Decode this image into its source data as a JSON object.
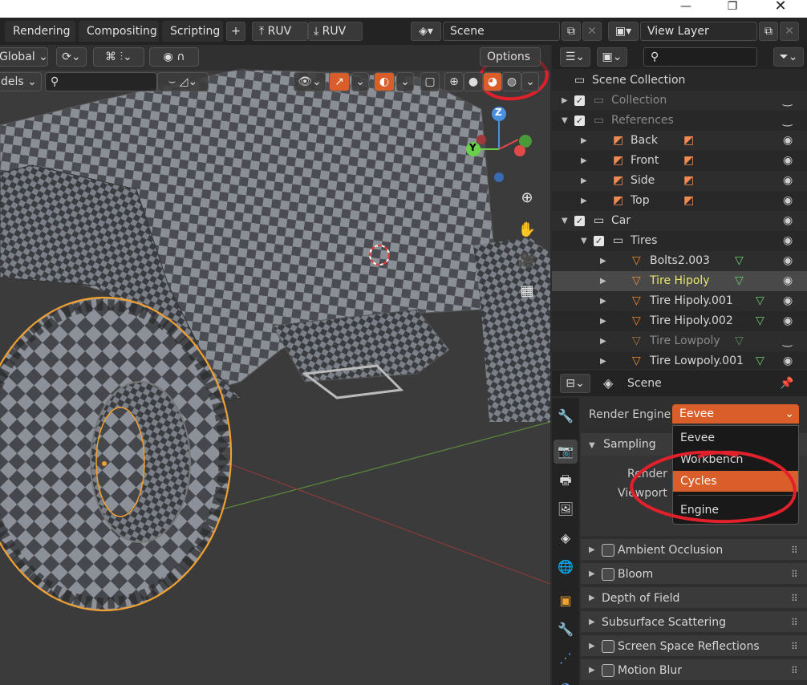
{
  "window": {
    "min_icon": "minimize-icon",
    "max_icon": "restore-icon",
    "close_icon": "close-icon"
  },
  "workspace_tabs": [
    "Rendering",
    "Compositing",
    "Scripting"
  ],
  "header": {
    "add_tab": "+",
    "ruv1": "RUV",
    "ruv2": "RUV",
    "scene_label": "Scene",
    "view_layer_label": "View Layer"
  },
  "viewport": {
    "transform_orientation": "Global",
    "mode_label": "dels",
    "options_label": "Options",
    "gizmo_z": "Z",
    "gizmo_y": "Y"
  },
  "outliner": {
    "search_placeholder": "",
    "rows": [
      {
        "label": "Scene Collection",
        "depth": 0,
        "icon": "collection-icon"
      },
      {
        "label": "Collection",
        "depth": 1,
        "icon": "collection-icon",
        "dim": true
      },
      {
        "label": "References",
        "depth": 1,
        "icon": "collection-icon",
        "dim": true
      },
      {
        "label": "Back",
        "depth": 2,
        "icon": "image-empty-icon"
      },
      {
        "label": "Front",
        "depth": 2,
        "icon": "image-empty-icon"
      },
      {
        "label": "Side",
        "depth": 2,
        "icon": "image-empty-icon"
      },
      {
        "label": "Top",
        "depth": 2,
        "icon": "image-empty-icon"
      },
      {
        "label": "Car",
        "depth": 1,
        "icon": "collection-icon"
      },
      {
        "label": "Tires",
        "depth": 2,
        "icon": "collection-icon"
      },
      {
        "label": "Bolts2.003",
        "depth": 3,
        "icon": "mesh-icon"
      },
      {
        "label": "Tire Hipoly",
        "depth": 3,
        "icon": "mesh-icon",
        "selected": true
      },
      {
        "label": "Tire Hipoly.001",
        "depth": 3,
        "icon": "mesh-icon"
      },
      {
        "label": "Tire Hipoly.002",
        "depth": 3,
        "icon": "mesh-icon"
      },
      {
        "label": "Tire Lowpoly",
        "depth": 3,
        "icon": "mesh-icon",
        "dim": true
      },
      {
        "label": "Tire Lowpoly.001",
        "depth": 3,
        "icon": "mesh-icon"
      }
    ]
  },
  "properties": {
    "context_label": "Scene",
    "render_engine_label": "Render Engine",
    "render_engine_value": "Eevee",
    "sampling_label": "Sampling",
    "render_label": "Render",
    "viewport_label": "Viewport",
    "panels": [
      "Ambient Occlusion",
      "Bloom",
      "Depth of Field",
      "Subsurface Scattering",
      "Screen Space Reflections",
      "Motion Blur"
    ],
    "panels_with_checkbox": [
      true,
      true,
      false,
      false,
      true,
      true
    ]
  },
  "dropdown": {
    "items": [
      "Eevee",
      "Workbench",
      "Cycles"
    ],
    "footer": "Engine",
    "highlighted": "Cycles"
  },
  "colors": {
    "accent": "#d95e2a",
    "selected_text": "#e8e86a",
    "annotation": "#e0202a",
    "object_outline": "#f0a030"
  }
}
